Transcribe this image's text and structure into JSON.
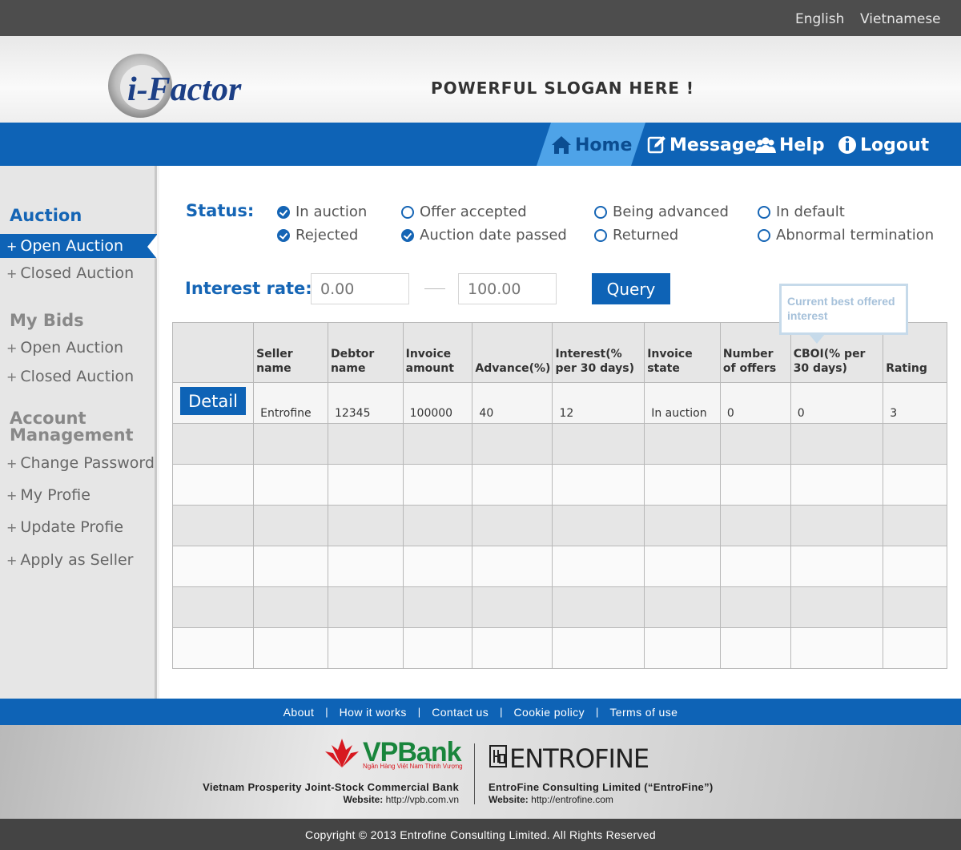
{
  "languages": {
    "english": "English",
    "vietnamese": "Vietnamese"
  },
  "header": {
    "logo_text": "i-Factor",
    "slogan": "POWERFUL SLOGAN HERE !"
  },
  "nav": {
    "home": "Home",
    "message": "Message",
    "help": "Help",
    "logout": "Logout"
  },
  "sidebar": {
    "auction_heading": "Auction",
    "auction_items": [
      "Open Auction",
      "Closed Auction"
    ],
    "bids_heading": "My Bids",
    "bids_items": [
      "Open Auction",
      "Closed Auction"
    ],
    "account_heading_line1": "Account",
    "account_heading_line2": "Management",
    "account_items": [
      "Change Password",
      "My Profie",
      "Update Profie",
      "Apply as Seller"
    ],
    "plus": "+"
  },
  "filters": {
    "status_label": "Status:",
    "statuses": [
      {
        "label": "In auction",
        "checked": true
      },
      {
        "label": "Offer accepted",
        "checked": false
      },
      {
        "label": "Being advanced",
        "checked": false
      },
      {
        "label": "In default",
        "checked": false
      },
      {
        "label": "Rejected",
        "checked": true
      },
      {
        "label": "Auction date passed",
        "checked": true
      },
      {
        "label": "Returned",
        "checked": false
      },
      {
        "label": "Abnormal termination",
        "checked": false
      }
    ],
    "interest_label": "Interest rate:",
    "interest_from_placeholder": "0.00",
    "interest_to_placeholder": "100.00",
    "query_label": "Query"
  },
  "tooltip": {
    "text_line1": "Current best offered",
    "text_line2": "interest"
  },
  "table": {
    "headers": [
      "",
      "Seller name",
      "Debtor name",
      "Invoice amount",
      "Advance(%)",
      "Interest(% per 30 days)",
      "Invoice state",
      "Number of offers",
      "CBOI(% per 30 days)",
      "Rating"
    ],
    "detail_label": "Detail",
    "rows": [
      [
        "",
        "Entrofine",
        "12345",
        "100000",
        "40",
        "12",
        "In auction",
        "0",
        "0",
        "3"
      ]
    ],
    "empty_rows": 6
  },
  "footer": {
    "links": [
      "About",
      "How it works",
      "Contact us",
      "Cookie policy",
      "Terms of use"
    ],
    "separator": "|",
    "vpbank_logo": "VPBank",
    "vpbank_tagline": "Ngân Hàng Việt Nam Thịnh Vượng",
    "bank_name": "Vietnam Prosperity Joint-Stock Commercial Bank",
    "bank_website_label": "Website:",
    "bank_website": "http://vpb.com.vn",
    "entrofine_logo": "ENTROFINE",
    "entrofine_name": "EntroFine Consulting Limited (“EntroFine”)",
    "entrofine_website_label": "Website:",
    "entrofine_website": "http://entrofine.com",
    "copyright": "Copyright © 2013 Entrofine Consulting Limited. All Rights Reserved"
  },
  "colors": {
    "brand_blue": "#0e63b6",
    "nav_home_highlight": "#4ea3e8",
    "vpbank_green": "#19853c",
    "vpbank_red": "#d71920"
  },
  "icons": [
    "home-icon",
    "edit-icon",
    "users-icon",
    "info-icon",
    "check-circle-icon",
    "circle-icon"
  ]
}
